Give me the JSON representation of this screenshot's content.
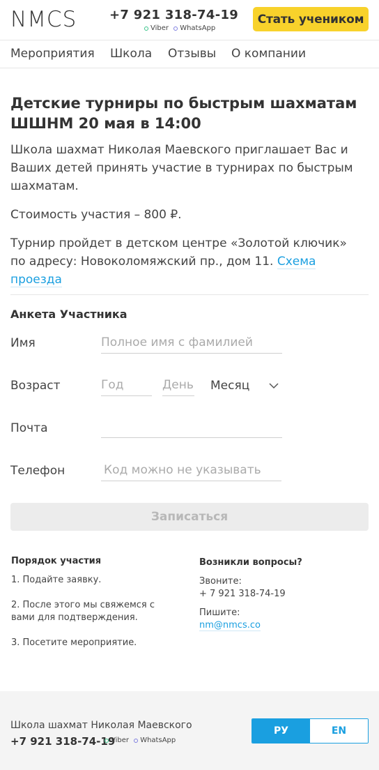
{
  "header": {
    "logo": "NMCS",
    "phone": "+7 921 318-74-19",
    "viber": "Viber",
    "whatsapp": "WhatsApp",
    "cta_label": "Стать учеником"
  },
  "nav": {
    "items": [
      "Мероприятия",
      "Школа",
      "Отзывы",
      "О компании"
    ]
  },
  "main": {
    "title": "Детские турниры по быстрым шахматам ШШНМ 20 мая в 14:00",
    "intro": "Школа шахмат Николая Маевского приглашает Вас и Ваших детей принять участие в турнирах по быстрым шахматам.",
    "price": "Стоимость участия – 800 ₽.",
    "venue": "Турнир пройдет в детском центре «Золотой ключик» по адресу: Новоколомяжский пр., дом 11.",
    "map_link": "Схема проезда"
  },
  "form": {
    "title": "Анкета Участника",
    "name_label": "Имя",
    "name_placeholder": "Полное имя с фамилией",
    "age_label": "Возраст",
    "year_placeholder": "Год",
    "day_placeholder": "День",
    "month_value": "Месяц",
    "email_label": "Почта",
    "email_value": "",
    "phone_label": "Телефон",
    "phone_placeholder": "Код можно не указывать",
    "submit_label": "Записаться"
  },
  "info": {
    "order_title": "Порядок участия",
    "steps": [
      "1. Подайте заявку.",
      "2. После этого мы свяжемся с вами для подтверждения.",
      "3. Посетите мероприятие."
    ],
    "questions_title": "Возникли вопросы?",
    "call_label": "Звоните:",
    "call_value": "+ 7 921 318-74-19",
    "write_label": "Пишите:",
    "email": "nm@nmcs.co"
  },
  "footer": {
    "school_name": "Школа шахмат Николая Маевского",
    "phone": "+7 921 318-74-19",
    "viber": "Viber",
    "whatsapp": "WhatsApp",
    "lang_ru": "РУ",
    "lang_en": "EN"
  },
  "colors": {
    "accent_yellow": "#f8d22b",
    "link_blue": "#1a9fe0",
    "viber_green": "#39c48a",
    "whatsapp_purple": "#7e7ee0"
  }
}
